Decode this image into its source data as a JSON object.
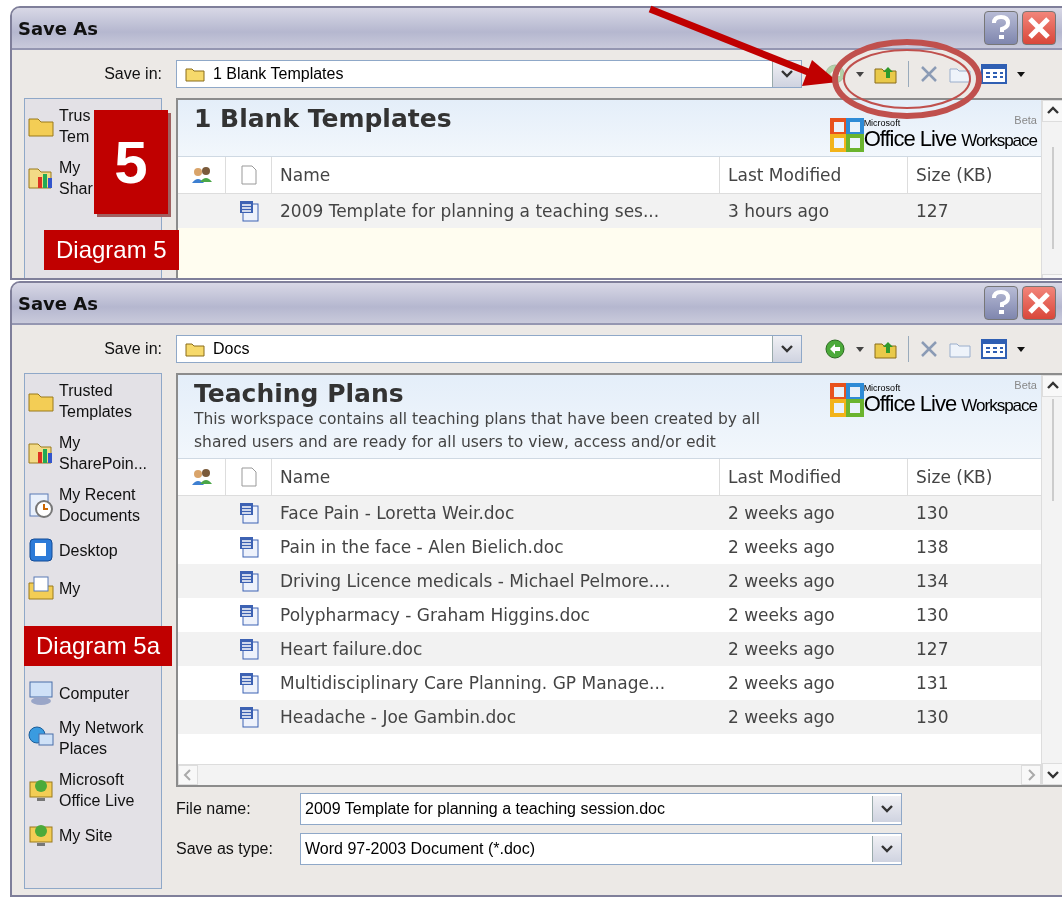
{
  "dialogs": [
    {
      "title": "Save As",
      "save_in_label": "Save in:",
      "save_in": "1 Blank Templates",
      "workspace": {
        "title": "1 Blank Templates",
        "logo_small": "Microsoft",
        "logo": "Office Live",
        "logo_suffix": "Workspace",
        "beta": "Beta"
      },
      "sidebar": [
        {
          "kind": "folder",
          "lines": [
            "Trus",
            "Tem"
          ]
        },
        {
          "kind": "sharepoint",
          "lines": [
            "My",
            "Shar"
          ]
        }
      ],
      "columns": [
        "Name",
        "Last Modified",
        "Size (KB)"
      ],
      "rows": [
        {
          "name": "2009 Template for planning a teaching ses...",
          "modified": "3 hours ago",
          "size": "127"
        }
      ]
    },
    {
      "title": "Save As",
      "save_in_label": "Save in:",
      "save_in": "Docs",
      "workspace": {
        "title": "Teaching Plans",
        "description": "This workspace contains all teaching plans that have been created by all shared users and are ready for all users to view, access and/or edit",
        "logo_small": "Microsoft",
        "logo": "Office Live",
        "logo_suffix": "Workspace",
        "beta": "Beta"
      },
      "sidebar": [
        {
          "kind": "folder",
          "lines": [
            "Trusted",
            "Templates"
          ]
        },
        {
          "kind": "sharepoint",
          "lines": [
            "My",
            "SharePoin..."
          ]
        },
        {
          "kind": "recent",
          "lines": [
            "My Recent",
            "Documents"
          ]
        },
        {
          "kind": "desktop",
          "lines": [
            "Desktop"
          ]
        },
        {
          "kind": "documents",
          "lines": [
            "My"
          ]
        },
        {
          "kind": "computer",
          "lines": [
            "Computer"
          ]
        },
        {
          "kind": "network",
          "lines": [
            "My Network",
            "Places"
          ]
        },
        {
          "kind": "officelive",
          "lines": [
            "Microsoft",
            "Office Live"
          ]
        },
        {
          "kind": "site",
          "lines": [
            "My Site"
          ]
        }
      ],
      "columns": [
        "Name",
        "Last Modified",
        "Size (KB)"
      ],
      "rows": [
        {
          "name": "Face Pain - Loretta Weir.doc",
          "modified": "2 weeks ago",
          "size": "130"
        },
        {
          "name": "Pain in the face - Alen Bielich.doc",
          "modified": "2 weeks ago",
          "size": "138"
        },
        {
          "name": "Driving Licence medicals - Michael Pelmore....",
          "modified": "2 weeks ago",
          "size": "134"
        },
        {
          "name": "Polypharmacy - Graham Higgins.doc",
          "modified": "2 weeks ago",
          "size": "130"
        },
        {
          "name": "Heart failure.doc",
          "modified": "2 weeks ago",
          "size": "127"
        },
        {
          "name": "Multidisciplinary Care Planning. GP Manage...",
          "modified": "2 weeks ago",
          "size": "131"
        },
        {
          "name": "Headache - Joe Gambin.doc",
          "modified": "2 weeks ago",
          "size": "130"
        }
      ],
      "file_name_label": "File name:",
      "file_name": "2009 Template for planning a teaching session.doc",
      "type_label": "Save as type:",
      "type": "Word 97-2003 Document (*.doc)"
    }
  ],
  "annotations": [
    {
      "kind": "number",
      "text": "5"
    },
    {
      "kind": "label",
      "text": "Diagram 5"
    },
    {
      "kind": "label",
      "text": "Diagram 5a"
    }
  ]
}
